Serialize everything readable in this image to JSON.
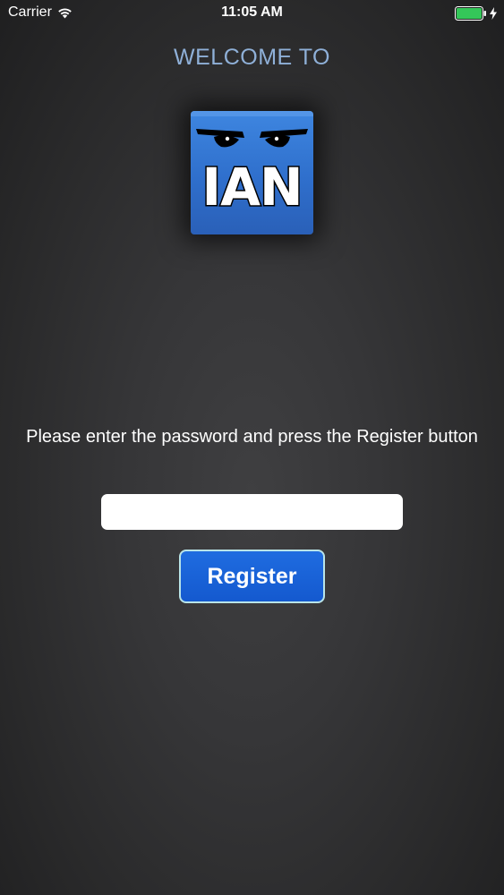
{
  "status_bar": {
    "carrier": "Carrier",
    "time": "11:05 AM",
    "wifi_icon": "wifi-icon",
    "battery_icon": "battery-icon",
    "charging_icon": "bolt-icon",
    "battery_color": "#34c759"
  },
  "welcome": {
    "title": "WELCOME TO"
  },
  "logo": {
    "text": "IAN",
    "icon": "angry-eyes-icon",
    "background_color": "#3e86e0"
  },
  "form": {
    "instruction": "Please enter the password and press the Register button",
    "password_value": "",
    "password_placeholder": "",
    "register_label": "Register",
    "accent_color": "#1a63d8"
  }
}
